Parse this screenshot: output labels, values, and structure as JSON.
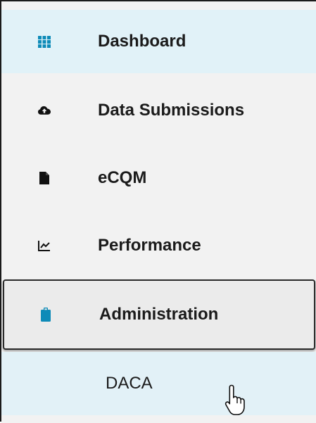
{
  "nav": {
    "items": [
      {
        "label": "Dashboard",
        "icon": "grid-icon",
        "active": false
      },
      {
        "label": "Data Submissions",
        "icon": "cloud-upload-icon",
        "active": false
      },
      {
        "label": "eCQM",
        "icon": "file-icon",
        "active": false
      },
      {
        "label": "Performance",
        "icon": "chart-line-icon",
        "active": false
      },
      {
        "label": "Administration",
        "icon": "clipboard-icon",
        "active": true
      }
    ],
    "subitems": [
      {
        "label": "DACA"
      }
    ]
  },
  "colors": {
    "accent": "#0e8bb8",
    "highlight_bg": "#e1f2f8",
    "menu_bg": "#f2f2f2",
    "text": "#1b1b1b"
  }
}
